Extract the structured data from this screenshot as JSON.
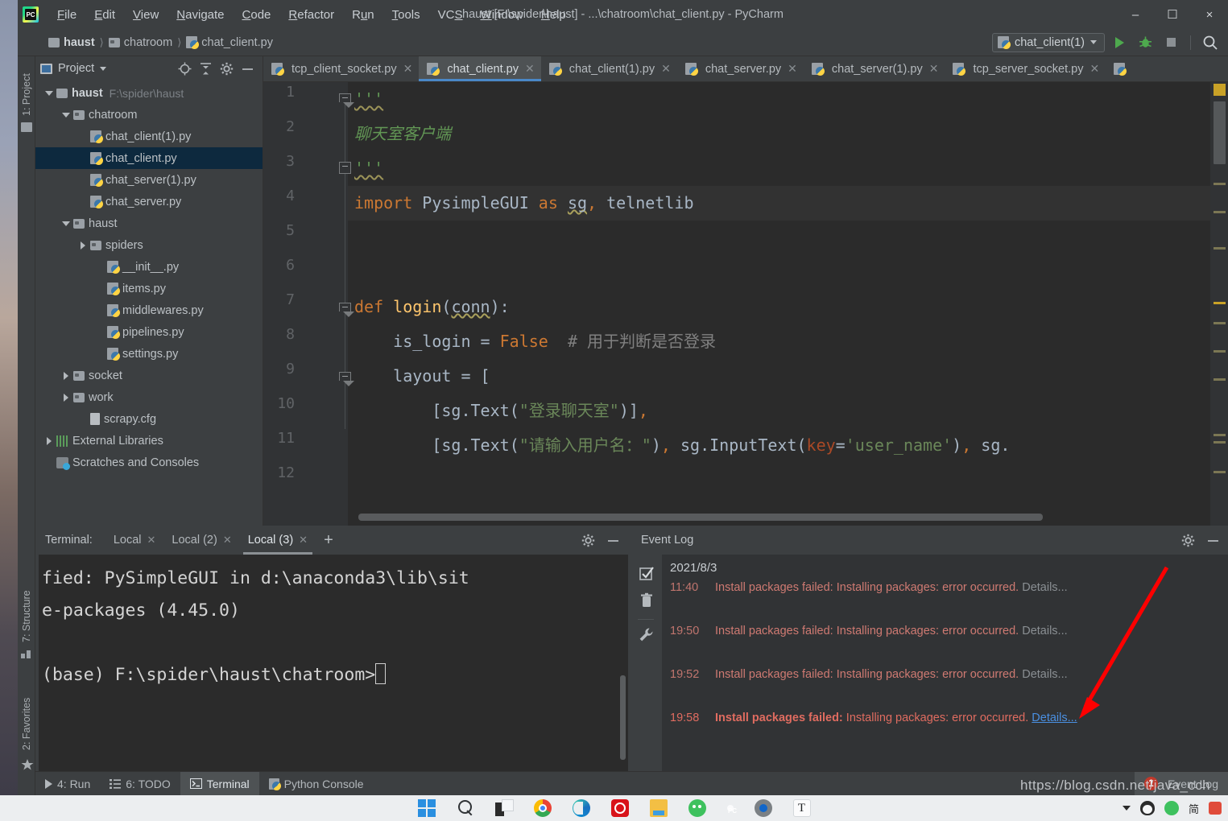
{
  "window": {
    "title": "haust [F:\\spider\\haust] - ...\\chatroom\\chat_client.py - PyCharm",
    "minimize": "–",
    "maximize": "☐",
    "close": "×"
  },
  "menu": [
    {
      "label": "File"
    },
    {
      "label": "Edit"
    },
    {
      "label": "View"
    },
    {
      "label": "Navigate"
    },
    {
      "label": "Code"
    },
    {
      "label": "Refactor"
    },
    {
      "label": "Run"
    },
    {
      "label": "Tools"
    },
    {
      "label": "VCS"
    },
    {
      "label": "Window"
    },
    {
      "label": "Help"
    }
  ],
  "breadcrumb": [
    {
      "label": "haust",
      "icon": "folder-icon"
    },
    {
      "label": "chatroom",
      "icon": "folder-icon"
    },
    {
      "label": "chat_client.py",
      "icon": "python-file-icon"
    }
  ],
  "toolbar": {
    "run_config": "chat_client(1)",
    "run_icon": "run-icon",
    "debug_icon": "debug-icon",
    "stop_icon": "stop-icon",
    "search_icon": "search-icon"
  },
  "left_stripes": [
    {
      "label": "1: Project",
      "icon": "folder-icon"
    },
    {
      "label": "7: Structure",
      "icon": "structure-icon"
    },
    {
      "label": "2: Favorites",
      "icon": "star-icon"
    }
  ],
  "project_panel": {
    "title": "Project",
    "locate_icon": "crosshair-icon",
    "collapse_icon": "collapse-all-icon",
    "settings_icon": "gear-icon",
    "hide_icon": "minimize-icon",
    "tree": [
      {
        "label": "haust",
        "path": "F:\\spider\\haust",
        "depth": 0,
        "toggle": "down",
        "icon": "folder-icon",
        "bold": true,
        "selected": false
      },
      {
        "label": "chatroom",
        "path": "",
        "depth": 1,
        "toggle": "down",
        "icon": "folder-icon",
        "bold": false,
        "selected": false
      },
      {
        "label": "chat_client(1).py",
        "path": "",
        "depth": 2,
        "toggle": "none",
        "icon": "python-file-icon",
        "bold": false,
        "selected": false
      },
      {
        "label": "chat_client.py",
        "path": "",
        "depth": 2,
        "toggle": "none",
        "icon": "python-file-icon",
        "bold": false,
        "selected": true
      },
      {
        "label": "chat_server(1).py",
        "path": "",
        "depth": 2,
        "toggle": "none",
        "icon": "python-file-icon",
        "bold": false,
        "selected": false
      },
      {
        "label": "chat_server.py",
        "path": "",
        "depth": 2,
        "toggle": "none",
        "icon": "python-file-icon",
        "bold": false,
        "selected": false
      },
      {
        "label": "haust",
        "path": "",
        "depth": 1,
        "toggle": "down",
        "icon": "folder-icon",
        "bold": false,
        "selected": false
      },
      {
        "label": "spiders",
        "path": "",
        "depth": 2,
        "toggle": "right",
        "icon": "folder-icon",
        "bold": false,
        "selected": false
      },
      {
        "label": "__init__.py",
        "path": "",
        "depth": 3,
        "toggle": "none",
        "icon": "python-file-icon",
        "bold": false,
        "selected": false
      },
      {
        "label": "items.py",
        "path": "",
        "depth": 3,
        "toggle": "none",
        "icon": "python-file-icon",
        "bold": false,
        "selected": false
      },
      {
        "label": "middlewares.py",
        "path": "",
        "depth": 3,
        "toggle": "none",
        "icon": "python-file-icon",
        "bold": false,
        "selected": false
      },
      {
        "label": "pipelines.py",
        "path": "",
        "depth": 3,
        "toggle": "none",
        "icon": "python-file-icon",
        "bold": false,
        "selected": false
      },
      {
        "label": "settings.py",
        "path": "",
        "depth": 3,
        "toggle": "none",
        "icon": "python-file-icon",
        "bold": false,
        "selected": false
      },
      {
        "label": "socket",
        "path": "",
        "depth": 1,
        "toggle": "right",
        "icon": "folder-icon",
        "bold": false,
        "selected": false
      },
      {
        "label": "work",
        "path": "",
        "depth": 1,
        "toggle": "right",
        "icon": "folder-icon",
        "bold": false,
        "selected": false
      },
      {
        "label": "scrapy.cfg",
        "path": "",
        "depth": 2,
        "toggle": "none",
        "icon": "config-file-icon",
        "bold": false,
        "selected": false
      },
      {
        "label": "External Libraries",
        "path": "",
        "depth": 0,
        "toggle": "right",
        "icon": "library-icon",
        "bold": false,
        "selected": false
      },
      {
        "label": "Scratches and Consoles",
        "path": "",
        "depth": 0,
        "toggle": "none",
        "icon": "scratches-icon",
        "bold": false,
        "selected": false
      }
    ]
  },
  "editor_tabs": [
    {
      "label": "tcp_client_socket.py",
      "active": false
    },
    {
      "label": "chat_client.py",
      "active": true
    },
    {
      "label": "chat_client(1).py",
      "active": false
    },
    {
      "label": "chat_server.py",
      "active": false
    },
    {
      "label": "chat_server(1).py",
      "active": false
    },
    {
      "label": "tcp_server_socket.py",
      "active": false
    }
  ],
  "code": {
    "line_numbers": [
      "1",
      "2",
      "3",
      "4",
      "5",
      "6",
      "7",
      "8",
      "9",
      "10",
      "11",
      "12"
    ],
    "lines": [
      "'''",
      "聊天室客户端",
      "'''",
      "import PysimpleGUI as sg, telnetlib",
      "",
      "",
      "def login(conn):",
      "    is_login = False  # 用于判断是否登录",
      "    layout = [",
      "        [sg.Text(\"登录聊天室\")],",
      "        [sg.Text(\"请输入用户名：\"), sg.InputText(key='user_name'), sg.",
      ""
    ]
  },
  "terminal": {
    "label": "Terminal:",
    "tabs": [
      {
        "label": "Local",
        "active": false
      },
      {
        "label": "Local (2)",
        "active": false
      },
      {
        "label": "Local (3)",
        "active": true
      }
    ],
    "add_label": "+",
    "settings_icon": "gear-icon",
    "hide_icon": "minimize-icon",
    "output_line1": "fied: PySimpleGUI in d:\\anaconda3\\lib\\sit",
    "output_line2": "e-packages (4.45.0)",
    "prompt": "(base) F:\\spider\\haust\\chatroom>"
  },
  "event_log": {
    "title": "Event Log",
    "settings_icon": "gear-icon",
    "hide_icon": "minimize-icon",
    "sidebar_icons": [
      "mark-read-icon",
      "trash-icon",
      "wrench-icon"
    ],
    "date": "2021/8/3",
    "entries": [
      {
        "time": "11:40",
        "bold_part": "",
        "message": "Install packages failed: Installing packages: error occurred.",
        "details": "Details...",
        "highlighted": false
      },
      {
        "time": "19:50",
        "bold_part": "",
        "message": "Install packages failed: Installing packages: error occurred.",
        "details": "Details...",
        "highlighted": false
      },
      {
        "time": "19:52",
        "bold_part": "",
        "message": "Install packages failed: Installing packages: error occurred.",
        "details": "Details...",
        "highlighted": false
      },
      {
        "time": "19:58",
        "bold_part": "Install packages failed:",
        "message": " Installing packages: error occurred.",
        "details": "Details...",
        "highlighted": true
      }
    ]
  },
  "status_bar": {
    "items": [
      {
        "label": "4: Run",
        "icon": "run-icon",
        "active": false
      },
      {
        "label": "6: TODO",
        "icon": "todo-icon",
        "active": false
      },
      {
        "label": "Terminal",
        "icon": "terminal-icon",
        "active": true
      },
      {
        "label": "Python Console",
        "icon": "python-icon",
        "active": false
      }
    ],
    "event_log_label": "Event Log",
    "event_log_badge": "1"
  },
  "taskbar": {
    "icons": [
      "windows-start-icon",
      "search-icon",
      "task-view-icon",
      "chrome-icon",
      "edge-icon",
      "netease-music-icon",
      "file-explorer-icon",
      "wechat-icon",
      "pycharm-icon",
      "settings-gear-icon",
      "typora-icon"
    ],
    "tray": [
      "show-hidden-icon",
      "qq-icon",
      "wechat-tray-icon",
      "ime-cn-icon",
      "red-app-icon"
    ],
    "tray_ime": "简"
  },
  "watermark": "https://blog.csdn.net/java_cch",
  "colors": {
    "accent": "#4a88c7",
    "selection": "#0d293e",
    "error": "#e06c60",
    "link": "#4a90e2",
    "keyword": "#cc7832",
    "string": "#6a8759",
    "docstring": "#629755",
    "function": "#ffc66d",
    "comment": "#808080",
    "editor_bg": "#2b2b2b",
    "panel_bg": "#3c3f41"
  }
}
